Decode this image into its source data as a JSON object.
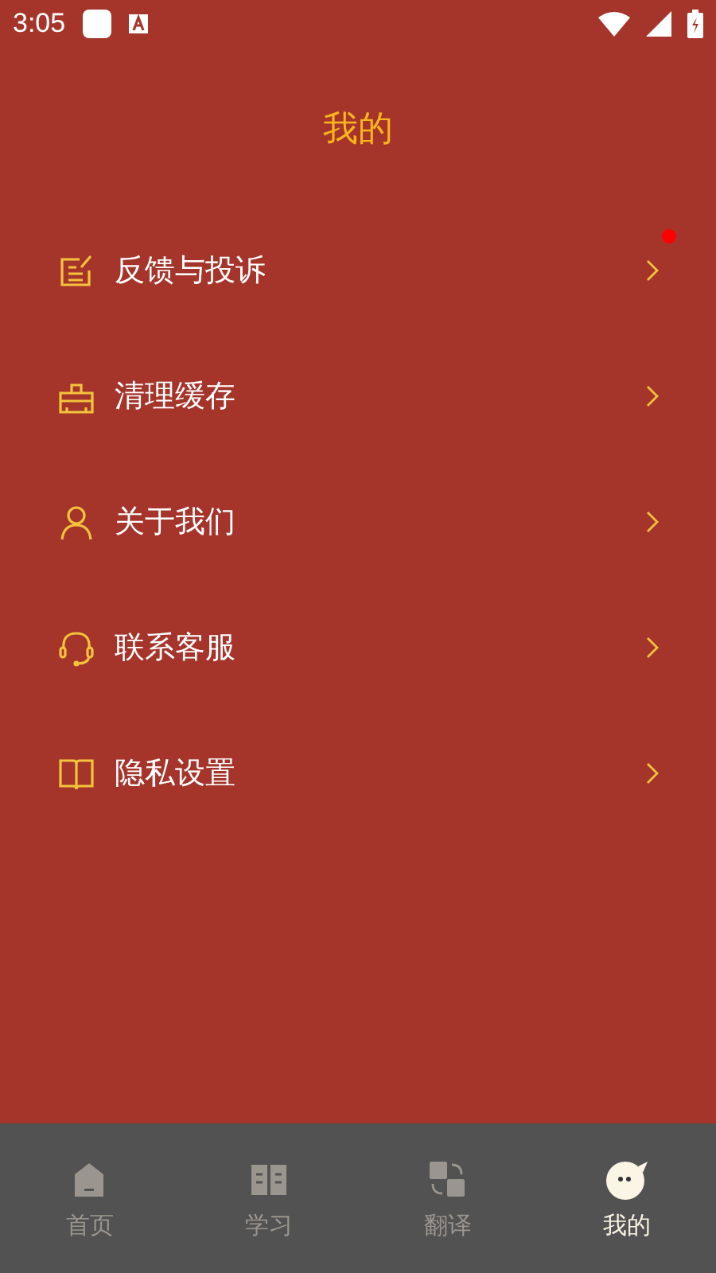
{
  "status_bar": {
    "time": "3:05"
  },
  "title": "我的",
  "menu": [
    {
      "kind": "feedback",
      "label": "反馈与投诉",
      "badge": true
    },
    {
      "kind": "clean",
      "label": "清理缓存",
      "badge": false
    },
    {
      "kind": "about",
      "label": "关于我们",
      "badge": false
    },
    {
      "kind": "service",
      "label": "联系客服",
      "badge": false
    },
    {
      "kind": "privacy",
      "label": "隐私设置",
      "badge": false
    }
  ],
  "tabs": [
    {
      "kind": "home",
      "label": "首页",
      "selected": false
    },
    {
      "kind": "study",
      "label": "学习",
      "selected": false
    },
    {
      "kind": "translate",
      "label": "翻译",
      "selected": false
    },
    {
      "kind": "me",
      "label": "我的",
      "selected": true
    }
  ]
}
